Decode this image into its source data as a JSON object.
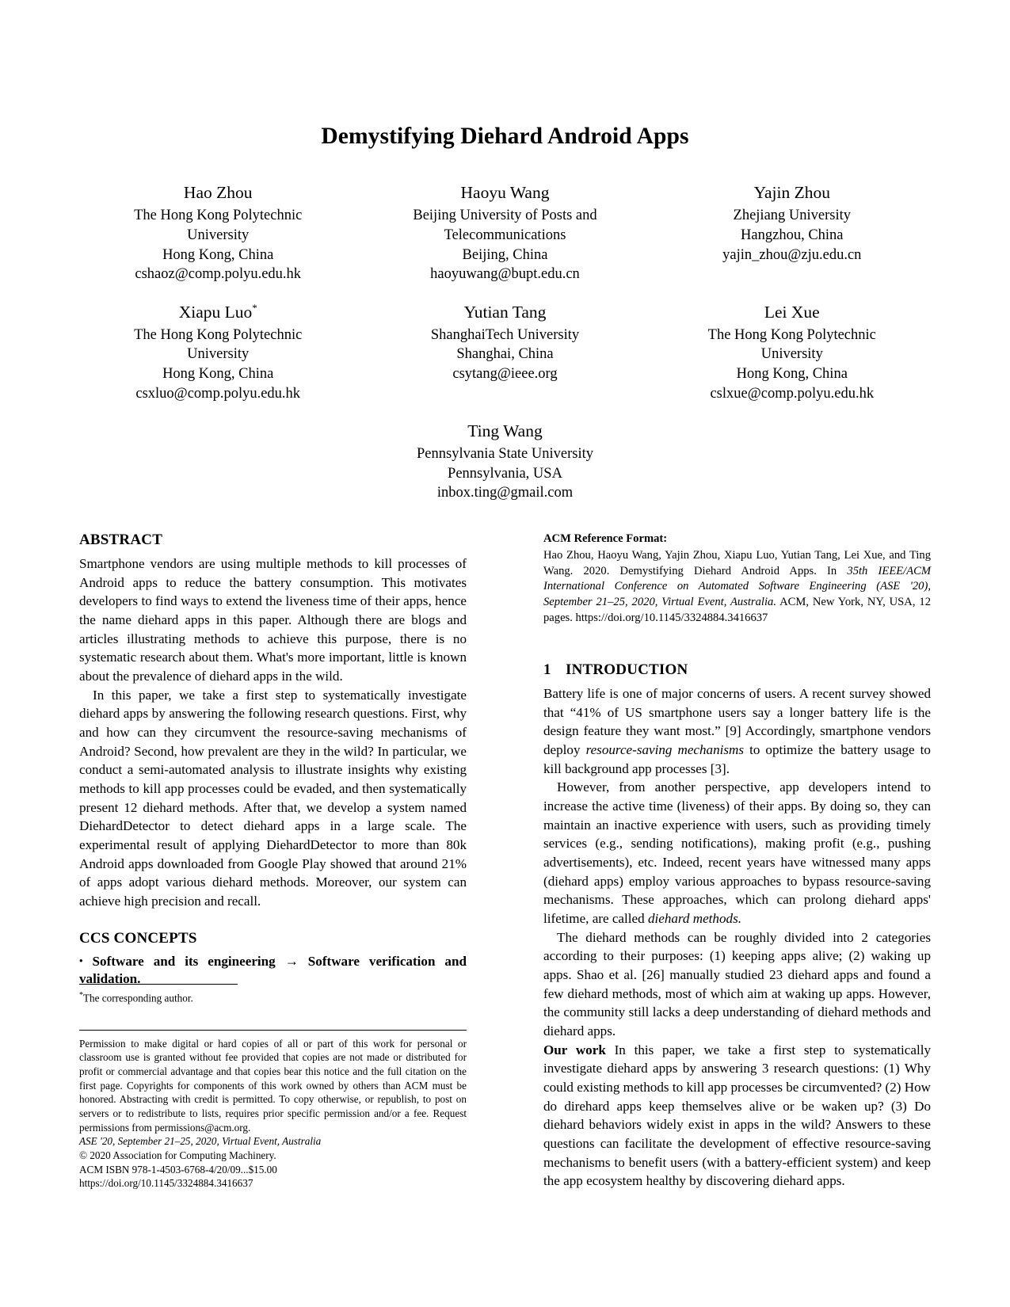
{
  "title": "Demystifying Diehard Android Apps",
  "authors": [
    {
      "name": "Hao Zhou",
      "affiliation1": "The Hong Kong Polytechnic",
      "affiliation2": "University",
      "location": "Hong Kong, China",
      "email": "cshaoz@comp.polyu.edu.hk",
      "star": ""
    },
    {
      "name": "Haoyu Wang",
      "affiliation1": "Beijing University of Posts and",
      "affiliation2": "Telecommunications",
      "location": "Beijing, China",
      "email": "haoyuwang@bupt.edu.cn",
      "star": ""
    },
    {
      "name": "Yajin Zhou",
      "affiliation1": "Zhejiang University",
      "affiliation2": "",
      "location": "Hangzhou, China",
      "email": "yajin_zhou@zju.edu.cn",
      "star": ""
    },
    {
      "name": "Xiapu Luo",
      "affiliation1": "The Hong Kong Polytechnic",
      "affiliation2": "University",
      "location": "Hong Kong, China",
      "email": "csxluo@comp.polyu.edu.hk",
      "star": "*"
    },
    {
      "name": "Yutian Tang",
      "affiliation1": "ShanghaiTech University",
      "affiliation2": "",
      "location": "Shanghai, China",
      "email": "csytang@ieee.org",
      "star": ""
    },
    {
      "name": "Lei Xue",
      "affiliation1": "The Hong Kong Polytechnic",
      "affiliation2": "University",
      "location": "Hong Kong, China",
      "email": "cslxue@comp.polyu.edu.hk",
      "star": ""
    }
  ],
  "author_last": {
    "name": "Ting Wang",
    "affiliation1": "Pennsylvania State University",
    "affiliation2": "",
    "location": "Pennsylvania, USA",
    "email": "inbox.ting@gmail.com",
    "star": ""
  },
  "abstract": {
    "heading": "ABSTRACT",
    "para1": "Smartphone vendors are using multiple methods to kill processes of Android apps to reduce the battery consumption. This motivates developers to find ways to extend the liveness time of their apps, hence the name diehard apps in this paper. Although there are blogs and articles illustrating methods to achieve this purpose, there is no systematic research about them. What's more important, little is known about the prevalence of diehard apps in the wild.",
    "para2": "In this paper, we take a first step to systematically investigate diehard apps by answering the following research questions. First, why and how can they circumvent the resource-saving mechanisms of Android? Second, how prevalent are they in the wild? In particular, we conduct a semi-automated analysis to illustrate insights why existing methods to kill app processes could be evaded, and then systematically present 12 diehard methods. After that, we develop a system named DiehardDetector to detect diehard apps in a large scale. The experimental result of applying DiehardDetector to more than 80k Android apps downloaded from Google Play showed that around 21% of apps adopt various diehard methods. Moreover, our system can achieve high precision and recall."
  },
  "ccs": {
    "heading": "CCS CONCEPTS",
    "bullet": "•",
    "text_bold_1": "Software and its engineering",
    "arrow": "→",
    "text_bold_2": "Software verification and validation."
  },
  "footnotes": {
    "corresponding": "The corresponding author.",
    "star": "*",
    "permission": "Permission to make digital or hard copies of all or part of this work for personal or classroom use is granted without fee provided that copies are not made or distributed for profit or commercial advantage and that copies bear this notice and the full citation on the first page. Copyrights for components of this work owned by others than ACM must be honored. Abstracting with credit is permitted. To copy otherwise, or republish, to post on servers or to redistribute to lists, requires prior specific permission and/or a fee. Request permissions from permissions@acm.org.",
    "conference": "ASE '20, September 21–25, 2020, Virtual Event, Australia",
    "copyright": "© 2020 Association for Computing Machinery.",
    "isbn": "ACM ISBN 978-1-4503-6768-4/20/09...$15.00",
    "doi": "https://doi.org/10.1145/3324884.3416637"
  },
  "reference_format": {
    "heading": "ACM Reference Format:",
    "part1": "Hao Zhou, Haoyu Wang, Yajin Zhou, Xiapu Luo, Yutian Tang, Lei Xue, and Ting Wang. 2020. Demystifying Diehard Android Apps. In ",
    "italic1": "35th IEEE/ACM International Conference on Automated Software Engineering (ASE '20), September 21–25, 2020, Virtual Event, Australia.",
    "part2": " ACM, New York, NY, USA, 12 pages. https://doi.org/10.1145/3324884.3416637"
  },
  "introduction": {
    "number": "1",
    "heading": "INTRODUCTION",
    "p1_a": "Battery life is one of major concerns of users. A recent survey showed that “41% of US smartphone users say a longer battery life is the design feature they want most.” [9] Accordingly, smartphone vendors deploy ",
    "p1_ital": "resource-saving mechanisms",
    "p1_b": " to optimize the battery usage to kill background app processes [3].",
    "p2_a": "However, from another perspective, app developers intend to increase the active time (liveness) of their apps. By doing so, they can maintain an inactive experience with users, such as providing timely services (e.g., sending notifications), making profit (e.g., pushing advertisements), etc. Indeed, recent years have witnessed many apps (diehard apps) employ various approaches to bypass resource-saving mechanisms. These approaches, which can prolong diehard apps' lifetime, are called ",
    "p2_ital": "diehard methods.",
    "p2_b": "",
    "p3": "The diehard methods can be roughly divided into 2 categories according to their purposes: (1) keeping apps alive; (2) waking up apps. Shao et al. [26] manually studied 23 diehard apps and found a few diehard methods, most of which aim at waking up apps. However, the community still lacks a deep understanding of diehard methods and diehard apps.",
    "p4_bold": "Our work",
    "p4_rest": " In this paper, we take a first step to systematically investigate diehard apps by answering 3 research questions: (1) Why could existing methods to kill app processes be circumvented? (2) How do direhard apps keep themselves alive or be waken up? (3) Do diehard behaviors widely exist in apps in the wild? Answers to these questions can facilitate the development of effective resource-saving mechanisms to benefit users (with a battery-efficient system) and keep the app ecosystem healthy by discovering diehard apps."
  }
}
